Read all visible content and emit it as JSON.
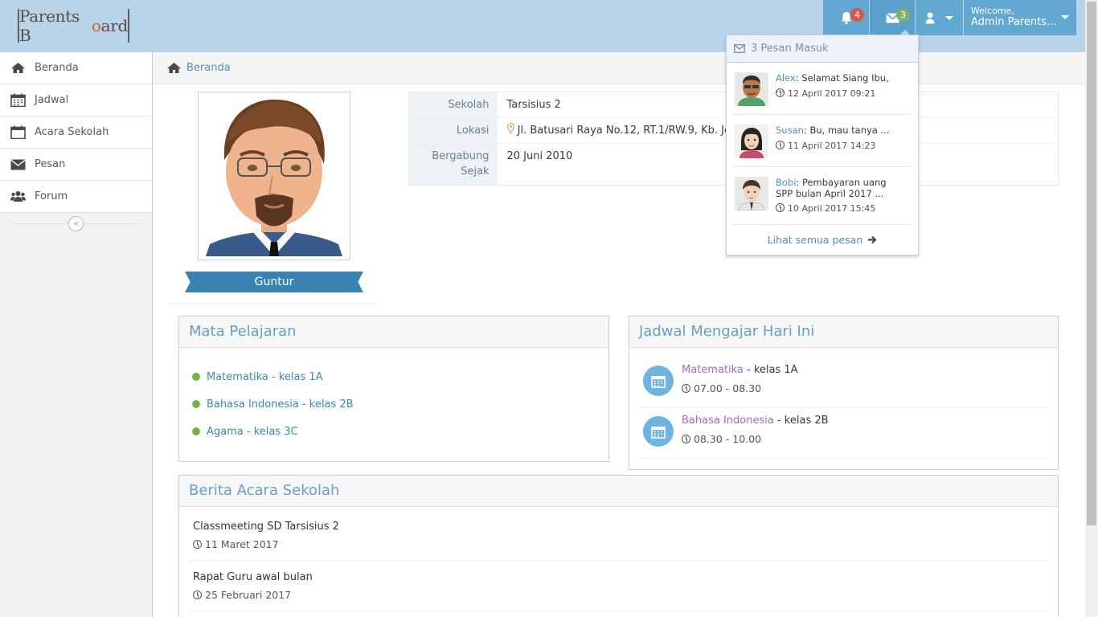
{
  "app": {
    "logo_text_part1": "Parents B",
    "logo_text_hl": "o",
    "logo_text_part2": "ard"
  },
  "navbar": {
    "notifications_count": "4",
    "messages_count": "3",
    "welcome_label": "Welcome,",
    "user_name": "Admin Parents...",
    "badge_colors": {
      "notifications": "#d15b47",
      "messages": "#82af6f"
    }
  },
  "sidebar": {
    "items": [
      {
        "label": "Beranda",
        "icon": "home-icon"
      },
      {
        "label": "Jadwal",
        "icon": "calendar-icon"
      },
      {
        "label": "Acara Sekolah",
        "icon": "calendar-icon"
      },
      {
        "label": "Pesan",
        "icon": "envelope-icon"
      },
      {
        "label": "Forum",
        "icon": "users-icon"
      }
    ],
    "collapse_glyph": "«"
  },
  "breadcrumb": {
    "home_label": "Beranda"
  },
  "profile": {
    "name": "Guntur",
    "fields": [
      {
        "label": "Sekolah",
        "value": "Tarsisius 2"
      },
      {
        "label": "Lokasi",
        "value": "Jl. Batusari Raya No.12, RT.1/RW.9, Kb. Jeruk"
      },
      {
        "label": "Bergabung Sejak",
        "value": "20 Juni 2010"
      }
    ]
  },
  "subjects": {
    "title": "Mata Pelajaran",
    "items": [
      "Matematika - kelas 1A",
      "Bahasa Indonesia - kelas 2B",
      "Agama - kelas 3C"
    ]
  },
  "schedule": {
    "title": "Jadwal Mengajar Hari Ini",
    "items": [
      {
        "subject": "Matematika",
        "class": " - kelas 1A",
        "time": "07.00 - 08.30"
      },
      {
        "subject": "Bahasa Indonesia",
        "class": " - kelas 2B",
        "time": "08.30 - 10.00"
      }
    ]
  },
  "news": {
    "title": "Berita Acara Sekolah",
    "items": [
      {
        "title": "Classmeeting SD Tarsisius 2",
        "date": "11 Maret 2017"
      },
      {
        "title": "Rapat Guru awal bulan",
        "date": "25 Februari 2017"
      }
    ]
  },
  "messages_dropdown": {
    "header": "3 Pesan Masuk",
    "items": [
      {
        "name": "Alex",
        "text": "Selamat Siang Ibu, ...",
        "time": "12 April 2017 09:21"
      },
      {
        "name": "Susan",
        "text": "Bu, mau tanya ...",
        "time": "11 April 2017 14:23"
      },
      {
        "name": "Bobi",
        "text": "Pembayaran uang SPP bulan April 2017 ...",
        "time": "10 April 2017 15:45"
      }
    ],
    "footer": "Lihat semua pesan"
  }
}
